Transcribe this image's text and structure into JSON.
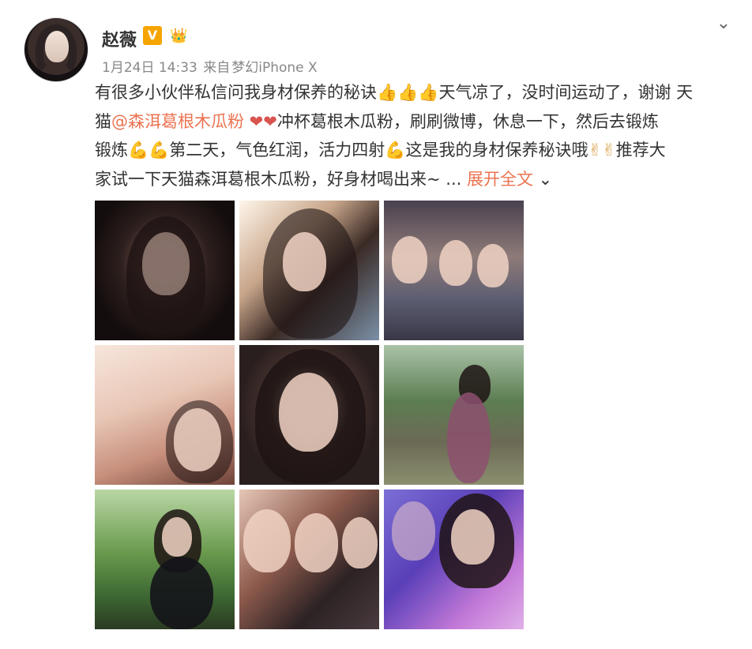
{
  "post": {
    "username": "赵薇",
    "vip_badge": "V",
    "timestamp": "1月24日 14:33",
    "source_prefix": "来自",
    "source_device": "梦幻iPhone X",
    "text_lines": [
      {
        "parts": [
          {
            "t": "有很多小伙伴私信问我身材保养的秘诀",
            "style": "normal"
          },
          {
            "t": "👍👍👍",
            "style": "gold"
          },
          {
            "t": "天气凉了，没时间运动了，谢谢 天",
            "style": "normal"
          }
        ]
      },
      {
        "parts": [
          {
            "t": "猫",
            "style": "normal"
          },
          {
            "t": "@森洱葛根木瓜粉",
            "style": "mention"
          },
          {
            "t": " ❤❤",
            "style": "emoji"
          },
          {
            "t": "冲杯葛根木瓜粉，刷刷微博，休息一下，然后去锻炼",
            "style": "normal"
          }
        ]
      },
      {
        "parts": [
          {
            "t": "锻炼",
            "style": "normal"
          },
          {
            "t": "💪💪",
            "style": "gold"
          },
          {
            "t": "第二天，气色红润，活力四射",
            "style": "normal"
          },
          {
            "t": "💪",
            "style": "gold"
          },
          {
            "t": "这是我的身材保养秘诀哦",
            "style": "normal"
          },
          {
            "t": "✌✌",
            "style": "gold"
          },
          {
            "t": "推荐大",
            "style": "normal"
          }
        ]
      },
      {
        "parts": [
          {
            "t": "家试一下天猫森洱葛根木瓜粉，好身材喝出来~ ... ",
            "style": "normal"
          },
          {
            "t": "展开全文",
            "style": "expand"
          },
          {
            "t": " ⌄",
            "style": "normal"
          }
        ]
      }
    ]
  },
  "icons": {
    "avatar": "avatar-image",
    "vip": "verified-v-icon",
    "member": "member-crown-icon",
    "chevron": "chevron-down-icon"
  },
  "photos": [
    {
      "name": "photo-1"
    },
    {
      "name": "photo-2"
    },
    {
      "name": "photo-3"
    },
    {
      "name": "photo-4"
    },
    {
      "name": "photo-5"
    },
    {
      "name": "photo-6"
    },
    {
      "name": "photo-7"
    },
    {
      "name": "photo-8"
    },
    {
      "name": "photo-9"
    }
  ],
  "colors": {
    "accent": "#eb7350",
    "text": "#333333",
    "meta": "#888888",
    "vip": "#f6a500"
  }
}
